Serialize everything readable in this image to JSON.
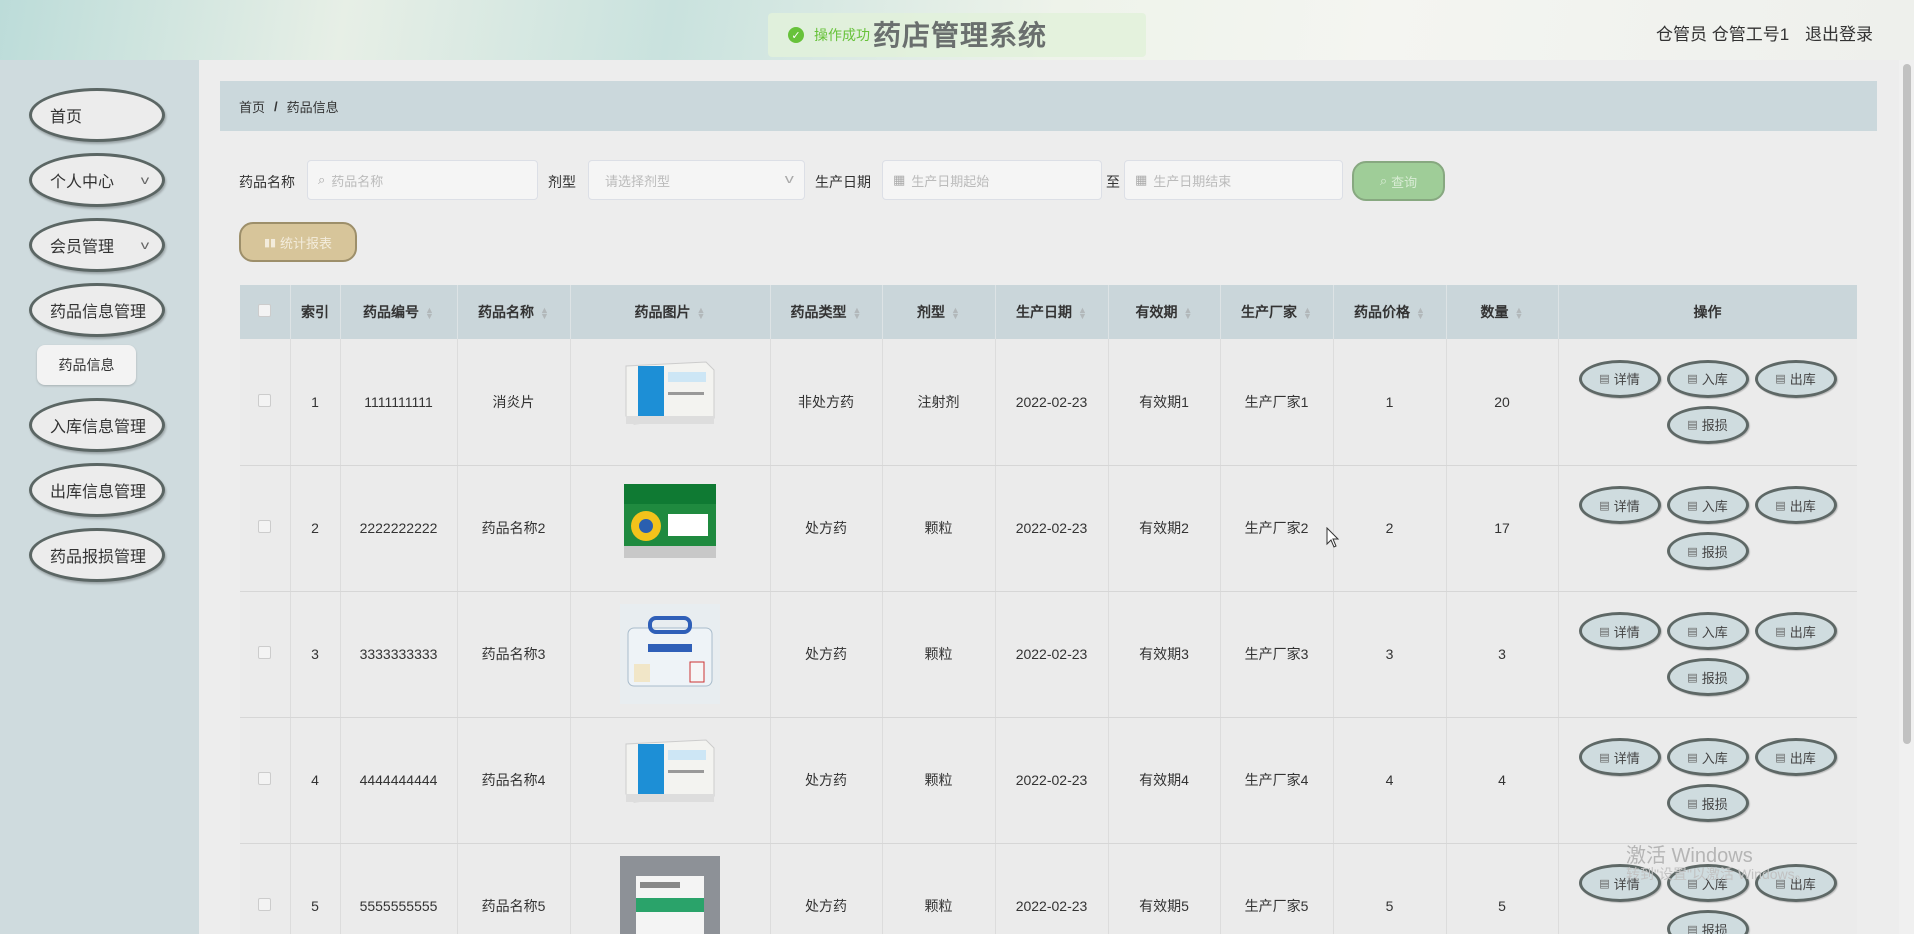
{
  "header": {
    "title": "药店管理系统",
    "toast": "操作成功",
    "user": "仓管员 仓管工号1",
    "logout": "退出登录"
  },
  "sidebar": {
    "items": [
      {
        "label": "首页",
        "has_chevron": false
      },
      {
        "label": "个人中心",
        "has_chevron": true
      },
      {
        "label": "会员管理",
        "has_chevron": true
      },
      {
        "label": "药品信息管理",
        "has_chevron": false
      },
      {
        "label": "入库信息管理",
        "has_chevron": false
      },
      {
        "label": "出库信息管理",
        "has_chevron": false
      },
      {
        "label": "药品报损管理",
        "has_chevron": false
      }
    ],
    "submenu_item": "药品信息"
  },
  "breadcrumb": {
    "home": "首页",
    "separator": "/",
    "current": "药品信息"
  },
  "search": {
    "name_label": "药品名称",
    "name_placeholder": "药品名称",
    "form_label": "剂型",
    "form_placeholder": "请选择剂型",
    "date_label": "生产日期",
    "date_start_placeholder": "生产日期起始",
    "date_to": "至",
    "date_end_placeholder": "生产日期结束",
    "query_button": "查询",
    "report_button": "统计报表"
  },
  "table": {
    "columns": [
      "索引",
      "药品编号",
      "药品名称",
      "药品图片",
      "药品类型",
      "剂型",
      "生产日期",
      "有效期",
      "生产厂家",
      "药品价格",
      "数量",
      "操作"
    ],
    "actions": {
      "detail": "详情",
      "stock_in": "入库",
      "stock_out": "出库",
      "loss": "报损"
    },
    "rows": [
      {
        "index": "1",
        "code": "1111111111",
        "name": "消炎片",
        "image": "blue-white-box",
        "type": "非处方药",
        "form": "注射剂",
        "date": "2022-02-23",
        "validity": "有效期1",
        "maker": "生产厂家1",
        "price": "1",
        "qty": "20"
      },
      {
        "index": "2",
        "code": "2222222222",
        "name": "药品名称2",
        "image": "green-box",
        "type": "处方药",
        "form": "颗粒",
        "date": "2022-02-23",
        "validity": "有效期2",
        "maker": "生产厂家2",
        "price": "2",
        "qty": "17"
      },
      {
        "index": "3",
        "code": "3333333333",
        "name": "药品名称3",
        "image": "medicine-case",
        "type": "处方药",
        "form": "颗粒",
        "date": "2022-02-23",
        "validity": "有效期3",
        "maker": "生产厂家3",
        "price": "3",
        "qty": "3"
      },
      {
        "index": "4",
        "code": "4444444444",
        "name": "药品名称4",
        "image": "blue-white-box",
        "type": "处方药",
        "form": "颗粒",
        "date": "2022-02-23",
        "validity": "有效期4",
        "maker": "生产厂家4",
        "price": "4",
        "qty": "4"
      },
      {
        "index": "5",
        "code": "5555555555",
        "name": "药品名称5",
        "image": "white-green-box",
        "type": "处方药",
        "form": "颗粒",
        "date": "2022-02-23",
        "validity": "有效期5",
        "maker": "生产厂家5",
        "price": "5",
        "qty": "5"
      }
    ]
  },
  "watermark": {
    "line1": "激活 Windows",
    "line2": "转到\"设置\"以激活 Windows。"
  }
}
